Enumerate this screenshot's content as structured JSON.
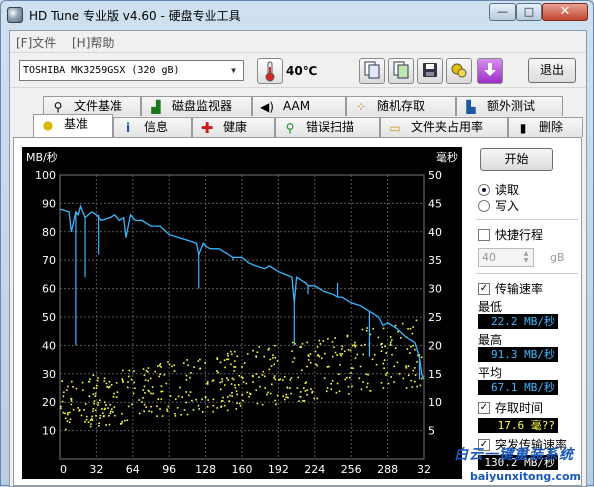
{
  "window": {
    "title": "HD Tune 专业版 v4.60 - 硬盘专业工具",
    "minimize": "—",
    "maximize": "□",
    "close": "✕"
  },
  "menu": [
    {
      "label": "[F]文件"
    },
    {
      "label": "[H]帮助"
    }
  ],
  "toolbar": {
    "drive": "TOSHIBA MK3259GSX (320 gB)",
    "temperature": "40℃",
    "exit_label": "退出",
    "icons": [
      "thermometer-icon",
      "copy-info-icon",
      "copy-screen-icon",
      "save-icon",
      "options-icon",
      "download-icon"
    ]
  },
  "tabs_top": [
    {
      "label": "文件基准",
      "icon": "file-benchmark-icon",
      "glyph": "⚲"
    },
    {
      "label": "磁盘监视器",
      "icon": "disk-monitor-icon",
      "glyph": "▟"
    },
    {
      "label": "AAM",
      "icon": "speaker-icon",
      "glyph": "◀)"
    },
    {
      "label": "随机存取",
      "icon": "random-access-icon",
      "glyph": "⁘"
    },
    {
      "label": "额外测试",
      "icon": "extra-tests-icon",
      "glyph": "▙"
    }
  ],
  "tabs_bottom": [
    {
      "label": "基准",
      "icon": "benchmark-icon",
      "glyph": "●",
      "active": true
    },
    {
      "label": "信息",
      "icon": "info-icon",
      "glyph": "i"
    },
    {
      "label": "健康",
      "icon": "health-cross-icon",
      "glyph": "✚"
    },
    {
      "label": "错误扫描",
      "icon": "error-scan-icon",
      "glyph": "⚲"
    },
    {
      "label": "文件夹占用率",
      "icon": "folder-usage-icon",
      "glyph": "▭"
    },
    {
      "label": "删除",
      "icon": "erase-trash-icon",
      "glyph": "▮"
    }
  ],
  "controls": {
    "start_label": "开始",
    "read_label": "读取",
    "write_label": "写入",
    "mode": "read",
    "short_stroke_label": "快捷行程",
    "short_stroke_checked": false,
    "short_stroke_value": "40",
    "short_stroke_unit": "gB",
    "transfer_rate_label": "传输速率",
    "transfer_rate_checked": true,
    "min_label": "最低",
    "min_value": "22.2 MB/秒",
    "max_label": "最高",
    "max_value": "91.3 MB/秒",
    "avg_label": "平均",
    "avg_value": "67.1 MB/秒",
    "access_time_label": "存取时间",
    "access_time_checked": true,
    "access_time_value": "17.6 毫??",
    "burst_label": "突发传输速率",
    "burst_checked": true,
    "burst_value": "130.2 MB/秒",
    "colors": {
      "blue_value": "#38b8ff",
      "yellow_value": "#ffff44"
    }
  },
  "chart_data": {
    "type": "line",
    "y_left_label": "MB/秒",
    "y_right_label": "毫秒",
    "ylim_left": [
      0,
      100
    ],
    "ylim_right": [
      0,
      50
    ],
    "y_left_ticks": [
      10,
      20,
      30,
      40,
      50,
      60,
      70,
      80,
      90,
      100
    ],
    "y_right_ticks": [
      5,
      10,
      15,
      20,
      25,
      30,
      35,
      40,
      45,
      50
    ],
    "xlim": [
      0,
      320
    ],
    "x_ticks": [
      0,
      32,
      64,
      96,
      128,
      160,
      192,
      224,
      256,
      288,
      320
    ],
    "x_tick_labels": [
      "0",
      "32",
      "64",
      "96",
      "128",
      "160",
      "192",
      "224",
      "256",
      "288",
      "32"
    ],
    "grid": true,
    "series": [
      {
        "axis": "left",
        "color": "#38b8ff",
        "x": [
          0,
          8,
          10,
          14,
          16,
          18,
          22,
          28,
          32,
          36,
          44,
          48,
          52,
          56,
          58,
          62,
          64,
          66,
          72,
          80,
          88,
          96,
          104,
          112,
          120,
          122,
          126,
          128,
          132,
          140,
          148,
          152,
          156,
          160,
          166,
          172,
          180,
          184,
          188,
          192,
          198,
          204,
          206,
          208,
          212,
          216,
          218,
          224,
          232,
          240,
          244,
          248,
          256,
          264,
          272,
          280,
          284,
          288,
          296,
          304,
          312,
          316,
          318,
          320
        ],
        "y": [
          88,
          87,
          80,
          87,
          86,
          89,
          85,
          87,
          86,
          84,
          85,
          86,
          84,
          85,
          78,
          86,
          85,
          84,
          84,
          82,
          82,
          79,
          78,
          77,
          76,
          72,
          76,
          75,
          74,
          74,
          72,
          71,
          71,
          71,
          69,
          68,
          67,
          68,
          67,
          66,
          65,
          64,
          55,
          64,
          63,
          62,
          61,
          61,
          59,
          58,
          57,
          57,
          55,
          54,
          52,
          50,
          47,
          48,
          46,
          43,
          41,
          36,
          30,
          28
        ]
      },
      {
        "axis": "right",
        "color": "#ffff44",
        "kind": "scatter",
        "x_range": [
          0,
          320
        ],
        "y_range_ms": [
          4,
          28
        ],
        "note_values_ms": {
          "typical": 17.6
        }
      }
    ]
  },
  "watermark": {
    "cn": "白云一键重装系统",
    "en": "baiyunxitong.com"
  }
}
